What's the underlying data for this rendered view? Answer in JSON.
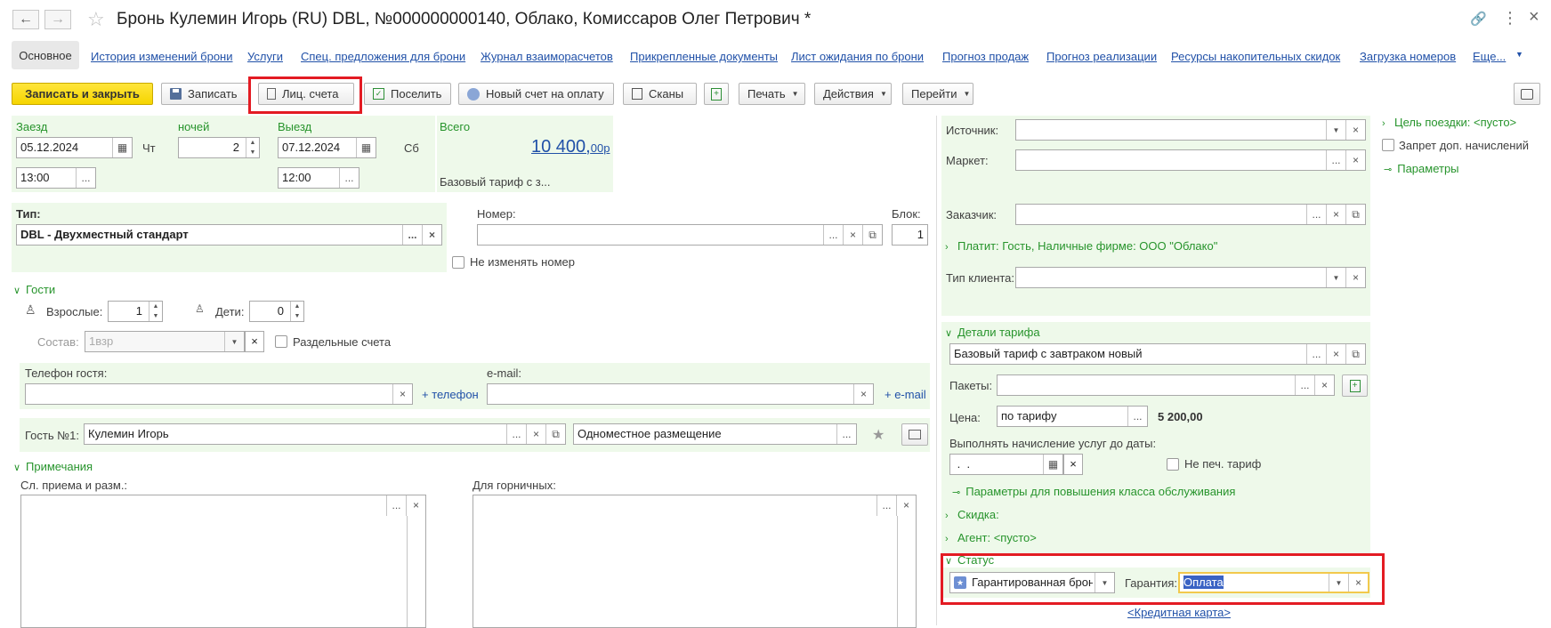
{
  "window": {
    "title": "Бронь Кулемин Игорь (RU) DBL, №000000000140, Облако, Комиссаров Олег Петрович *"
  },
  "tabs": [
    {
      "label": "Основное",
      "active": true
    },
    {
      "label": "История изменений брони"
    },
    {
      "label": "Услуги"
    },
    {
      "label": "Спец. предложения для брони"
    },
    {
      "label": "Журнал взаиморасчетов"
    },
    {
      "label": "Прикрепленные документы"
    },
    {
      "label": "Лист ожидания по брони"
    },
    {
      "label": "Прогноз продаж"
    },
    {
      "label": "Прогноз реализации"
    },
    {
      "label": "Ресурсы накопительных скидок"
    },
    {
      "label": "Загрузка номеров"
    },
    {
      "label": "Еще..."
    }
  ],
  "toolbar": {
    "save_close": "Записать и закрыть",
    "save": "Записать",
    "accounts": "Лиц. счета",
    "checkin": "Поселить",
    "new_invoice": "Новый счет на оплату",
    "scans": "Сканы",
    "print": "Печать",
    "actions": "Действия",
    "goto": "Перейти"
  },
  "stay": {
    "checkin_label": "Заезд",
    "checkin_date": "05.12.2024",
    "checkin_dow": "Чт",
    "checkin_time": "13:00",
    "nights_label": "ночей",
    "nights": "2",
    "checkout_label": "Выезд",
    "checkout_date": "07.12.2024",
    "checkout_dow": "Сб",
    "checkout_time": "12:00",
    "total_label": "Всего",
    "total_main": "10 400,",
    "total_cents": "00р",
    "tariff_short": "Базовый тариф с з..."
  },
  "room": {
    "type_label": "Тип:",
    "type_value": "DBL - Двухместный стандарт",
    "number_label": "Номер:",
    "number_value": "",
    "block_label": "Блок:",
    "block_value": "1",
    "keep_number": "Не изменять номер"
  },
  "guests": {
    "section": "Гости",
    "adults_label": "Взрослые:",
    "adults": "1",
    "children_label": "Дети:",
    "children": "0",
    "composition_label": "Состав:",
    "composition_placeholder": "1взр",
    "separate_accounts": "Раздельные счета",
    "phone_label": "Телефон гостя:",
    "add_phone": "+ телефон",
    "email_label": "e-mail:",
    "add_email": "+ e-mail",
    "guest1_label": "Гость №1:",
    "guest1_name": "Кулемин Игорь",
    "accommodation": "Одноместное размещение"
  },
  "notes": {
    "section": "Примечания",
    "reception_label": "Сл. приема и разм.:",
    "housekeeping_label": "Для горничных:"
  },
  "right": {
    "source_label": "Источник:",
    "market_label": "Маркет:",
    "customer_label": "Заказчик:",
    "payer": "Платит: Гость, Наличные фирме: ООО \"Облако\"",
    "client_type_label": "Тип клиента:",
    "tariff_section": "Детали тарифа",
    "tariff_value": "Базовый тариф с завтраком новый",
    "packages_label": "Пакеты:",
    "price_label": "Цена:",
    "price_mode": "по тарифу",
    "price_value": "5 200,00",
    "charge_until_label": "Выполнять начисление услуг до даты:",
    "charge_until_value": " .  .",
    "no_print_tariff": "Не печ. тариф",
    "upgrade_params": "Параметры для повышения класса обслуживания",
    "discount": "Скидка:",
    "agent": "Агент: <пусто>",
    "status_section": "Статус",
    "status_value": "Гарантированная бронь",
    "guarantee_label": "Гарантия:",
    "guarantee_value": "Оплата",
    "credit_card": "<Кредитная карта>"
  },
  "far_right": {
    "trip_purpose": "Цель поездки: <пусто>",
    "no_extra_charges": "Запрет доп. начислений",
    "params": "Параметры"
  },
  "colors": {
    "accent_green": "#27942c",
    "primary_yellow": "#f5d500",
    "link_blue": "#2151a8",
    "highlight_red": "#e31b23",
    "panel_green": "#eef9ea"
  }
}
